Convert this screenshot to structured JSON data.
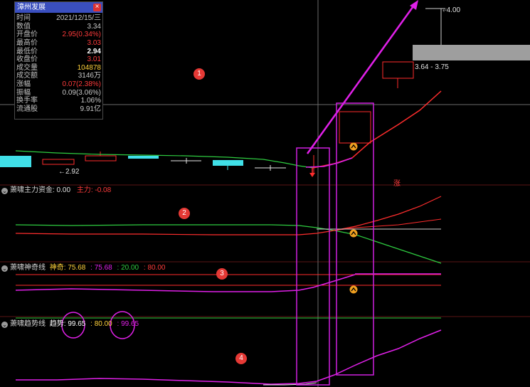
{
  "info_panel": {
    "title": "漳州发展",
    "close_glyph": "×",
    "rows": [
      {
        "k": "时间",
        "v": "2021/12/15/三"
      },
      {
        "k": "数值",
        "v": "3.34"
      },
      {
        "k": "开盘价",
        "v": "2.95(0.34%)"
      },
      {
        "k": "最高价",
        "v": "3.03"
      },
      {
        "k": "最低价",
        "v": "2.94"
      },
      {
        "k": "收盘价",
        "v": "3.01"
      },
      {
        "k": "成交量",
        "v": "104878"
      },
      {
        "k": "成交额",
        "v": "3146万"
      },
      {
        "k": "涨幅",
        "v": "0.07(2.38%)"
      },
      {
        "k": "振幅",
        "v": "0.09(3.06%)"
      },
      {
        "k": "换手率",
        "v": "1.06%"
      },
      {
        "k": "流通股",
        "v": "9.91亿"
      }
    ]
  },
  "price_labels": {
    "high_target": "4.00",
    "range": "3.64 - 3.75",
    "low_mark": "2.92",
    "zhang": "涨"
  },
  "indicators": {
    "main_fund": {
      "name": "萧啸主力资金",
      "value": ": 0.00",
      "sub_label": "主力",
      "sub_value": ": -0.08"
    },
    "shenqi": {
      "name": "萧啸神奇线",
      "label": "神奇",
      "v1": ": 75.68",
      "v2": ": 75.68",
      "v3": ": 20.00",
      "v4": ": 80.00"
    },
    "trend": {
      "name": "萧啸趋势线",
      "label": "趋势",
      "v1": ": 99.65",
      "v2": ": 80.00",
      "v3": ": 99.65"
    }
  },
  "badges": [
    "1",
    "2",
    "3",
    "4"
  ],
  "icons": {
    "indicator_toggle": "chevron-down-icon",
    "signal": "up-arrow-circle-icon"
  },
  "colors": {
    "bg": "#000000",
    "red": "#ff2d2d",
    "green": "#2ecc40",
    "magenta": "#e020e8",
    "cyan": "#40e0e8",
    "yellow": "#ffd23b",
    "white": "#e8e8e8",
    "grid_red": "#6b1a1a",
    "highlight_box": "#d020e0"
  }
}
